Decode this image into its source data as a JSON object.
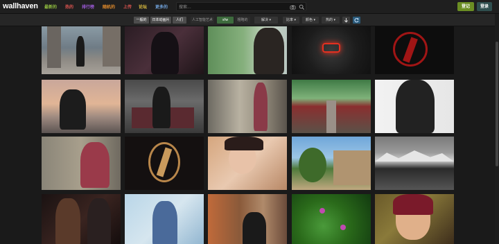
{
  "header": {
    "logo": "wallhaven",
    "nav": [
      {
        "label": "最新的",
        "color": "#8fbc3f"
      },
      {
        "label": "热的",
        "color": "#d9534f"
      },
      {
        "label": "排行榜",
        "color": "#9b59d6"
      },
      {
        "label": "随机的",
        "color": "#e08a2b"
      },
      {
        "label": "上传",
        "color": "#d9534f"
      },
      {
        "label": "论坛",
        "color": "#e0c040"
      },
      {
        "label": "更多的",
        "color": "#6fa0d8"
      }
    ],
    "search_placeholder": "搜索...",
    "upload_label": "登记",
    "login_label": "登录"
  },
  "filters": {
    "category": [
      "一般的",
      "日本动画片",
      "人们"
    ],
    "ai_label": "人工智能艺术",
    "purity": [
      "sfw",
      "粗略的"
    ],
    "resolution": "解决",
    "ratio": "比率",
    "color": "颜色",
    "sort": "热的"
  }
}
